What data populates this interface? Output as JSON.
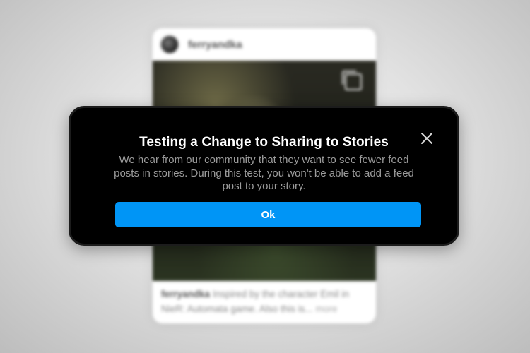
{
  "background_post": {
    "username": "ferryandka",
    "caption_user": "ferryandka",
    "caption_text": "Inspired by the character Emil in NieR: Automata game. Also this is...",
    "caption_more": "more",
    "icons": {
      "avatar": "avatar",
      "carousel": "multiple-images-icon"
    }
  },
  "dialog": {
    "title": "Testing a Change to Sharing to Stories",
    "body": "We hear from our community that they want to see fewer feed posts in stories. During this test, you won't be able to add a feed post to your story.",
    "ok_label": "Ok",
    "close_icon": "close-icon",
    "colors": {
      "background": "#000000",
      "button": "#0095f6",
      "title": "#ffffff",
      "body": "#9c9c9c"
    }
  }
}
